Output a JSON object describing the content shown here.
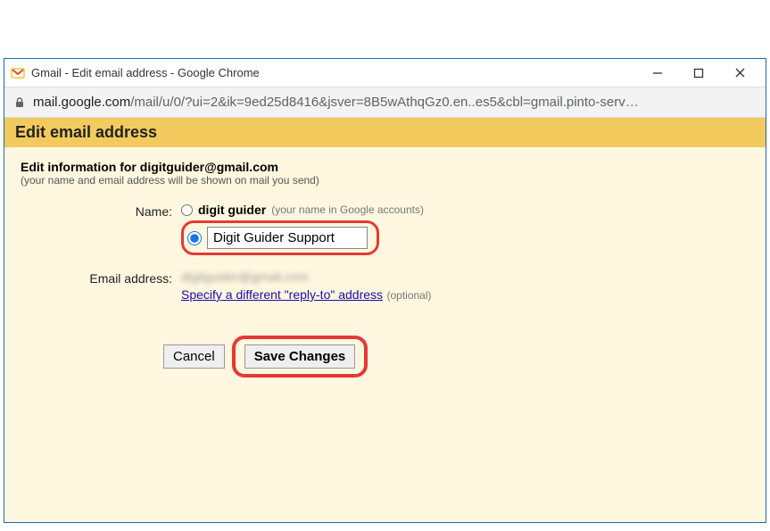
{
  "window": {
    "title": "Gmail - Edit email address - Google Chrome"
  },
  "address": {
    "host": "mail.google.com",
    "path": "/mail/u/0/?ui=2&ik=9ed25d8416&jsver=8B5wAthqGz0.en..es5&cbl=gmail.pinto-serv…"
  },
  "page": {
    "heading": "Edit email address",
    "info_heading": "Edit information for digitguider@gmail.com",
    "info_sub": "(your name and email address will be shown on mail you send)"
  },
  "form": {
    "name_label": "Name:",
    "google_name": "digit guider",
    "google_hint": "(your name in Google accounts)",
    "custom_name_value": "Digit Guider Support",
    "email_label": "Email address:",
    "email_value": "digitguider@gmail.com",
    "reply_link": "Specify a different \"reply-to\" address",
    "optional": "(optional)"
  },
  "buttons": {
    "cancel": "Cancel",
    "save": "Save Changes"
  }
}
